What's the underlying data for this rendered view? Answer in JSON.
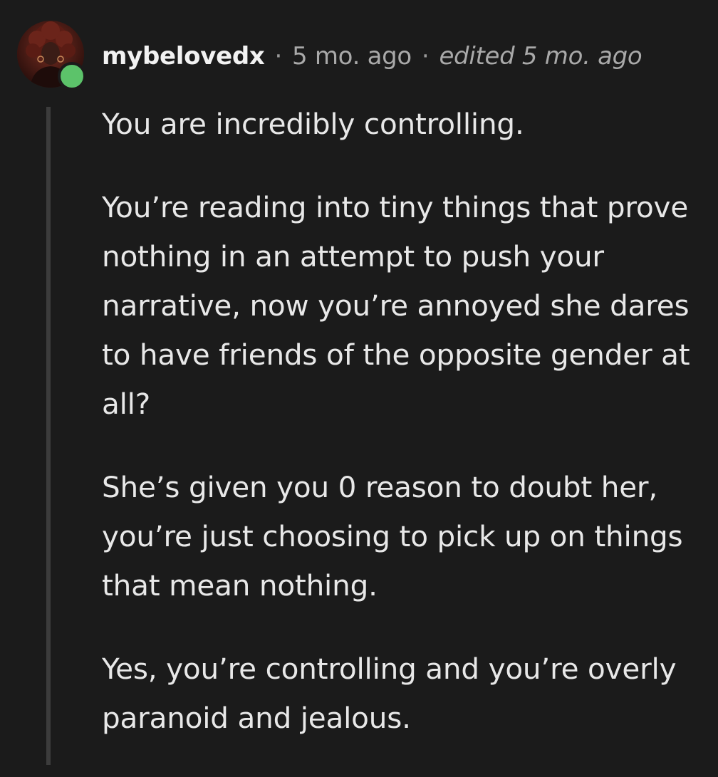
{
  "comment": {
    "author": "mybelovedx",
    "separator": "·",
    "time_ago": "5 mo. ago",
    "edited_label": "edited 5 mo. ago",
    "online_status_color": "#5cc36a",
    "avatar_icon": "user-avatar-icon",
    "paragraphs": [
      "You are incredibly controlling.",
      "You’re reading into tiny things that prove nothing in an attempt to push your narrative, now you’re annoyed she dares to have friends of the opposite gender at all?",
      "She’s given you 0 reason to doubt her, you’re just choosing to pick up on things that mean nothing.",
      "Yes, you’re controlling and you’re overly paranoid and jealous."
    ]
  }
}
